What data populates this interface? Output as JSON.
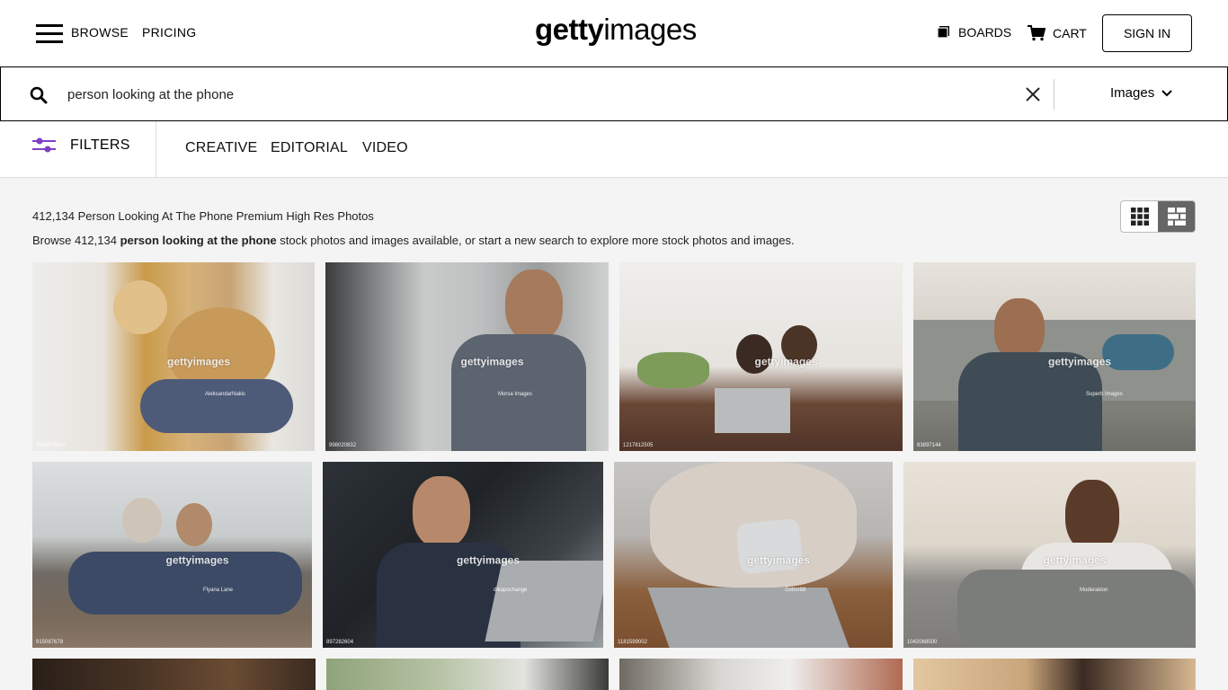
{
  "header": {
    "nav": [
      "BROWSE",
      "PRICING"
    ],
    "logo_bold": "getty",
    "logo_light": "images",
    "boards_label": "BOARDS",
    "cart_label": "CART",
    "signin_label": "SIGN IN"
  },
  "search": {
    "query": "person looking at the phone",
    "media_type": "Images"
  },
  "filters": {
    "label": "FILTERS",
    "tabs": [
      "CREATIVE",
      "EDITORIAL",
      "VIDEO"
    ]
  },
  "results": {
    "title": "412,134 Person Looking At The Phone Premium High Res Photos",
    "desc_prefix": "Browse 412,134 ",
    "desc_bold": "person looking at the phone",
    "desc_suffix": " stock photos and images available, or start a new search to explore more stock photos and images."
  },
  "watermark": "gettyimages",
  "images": [
    {
      "credit": "AleksandarNakic",
      "id": "1188478540"
    },
    {
      "credit": "Morsa Images",
      "id": "998020832"
    },
    {
      "credit": "",
      "id": "1217812505"
    },
    {
      "credit": "Superb Images",
      "id": "83897144"
    },
    {
      "credit": "Flyana Lane",
      "id": "915087678"
    },
    {
      "credit": "dikapochange",
      "id": "897282604"
    },
    {
      "credit": "Gobor88",
      "id": "1181599002"
    },
    {
      "credit": "Moderaklon",
      "id": "1042068500"
    }
  ],
  "icons": {
    "menu": "hamburger-icon",
    "boards": "boards-icon",
    "cart": "cart-icon",
    "search": "search-icon",
    "clear": "close-icon",
    "chevron": "chevron-down-icon",
    "filters": "sliders-icon",
    "grid": "grid-view-icon",
    "mosaic": "mosaic-view-icon"
  },
  "colors": {
    "accent": "#7d3fc6",
    "page_bg": "#f4f4f4"
  }
}
